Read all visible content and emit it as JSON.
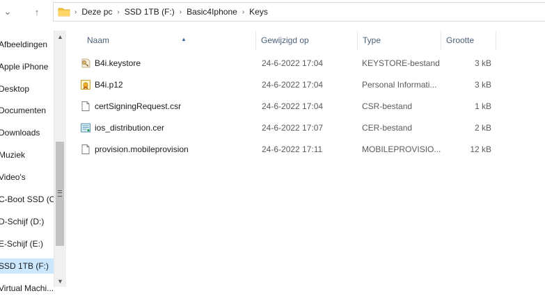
{
  "address_bar": {
    "breadcrumbs": [
      "Deze pc",
      "SSD 1TB (F:)",
      "Basic4Iphone",
      "Keys"
    ],
    "folder_icon": "folder-icon"
  },
  "nav": {
    "back_icon": "arrow-left-icon",
    "up_icon": "arrow-up-icon"
  },
  "sidebar": {
    "items": [
      {
        "label": "Afbeeldingen"
      },
      {
        "label": "Apple iPhone"
      },
      {
        "label": "Desktop"
      },
      {
        "label": "Documenten"
      },
      {
        "label": "Downloads"
      },
      {
        "label": "Muziek"
      },
      {
        "label": "Video's"
      },
      {
        "label": "C-Boot SSD (C:)"
      },
      {
        "label": "D-Schijf (D:)"
      },
      {
        "label": "E-Schijf (E:)"
      },
      {
        "label": "SSD 1TB (F:)"
      },
      {
        "label": "Virtual Machi..."
      }
    ],
    "selected": "SSD 1TB (F:)"
  },
  "columns": {
    "name": "Naam",
    "modified": "Gewijzigd op",
    "type": "Type",
    "size": "Grootte"
  },
  "files": [
    {
      "name": "B4i.keystore",
      "modified": "24-6-2022 17:04",
      "type": "KEYSTORE-bestand",
      "size": "3 kB",
      "icon": "keystore-file-icon"
    },
    {
      "name": "B4i.p12",
      "modified": "24-6-2022 17:04",
      "type": "Personal Informati...",
      "size": "3 kB",
      "icon": "certificate-file-icon"
    },
    {
      "name": "certSigningRequest.csr",
      "modified": "24-6-2022 17:04",
      "type": "CSR-bestand",
      "size": "1 kB",
      "icon": "generic-file-icon"
    },
    {
      "name": "ios_distribution.cer",
      "modified": "24-6-2022 17:07",
      "type": "CER-bestand",
      "size": "2 kB",
      "icon": "cer-file-icon"
    },
    {
      "name": "provision.mobileprovision",
      "modified": "24-6-2022 17:11",
      "type": "MOBILEPROVISIO...",
      "size": "12 kB",
      "icon": "generic-file-icon"
    }
  ]
}
